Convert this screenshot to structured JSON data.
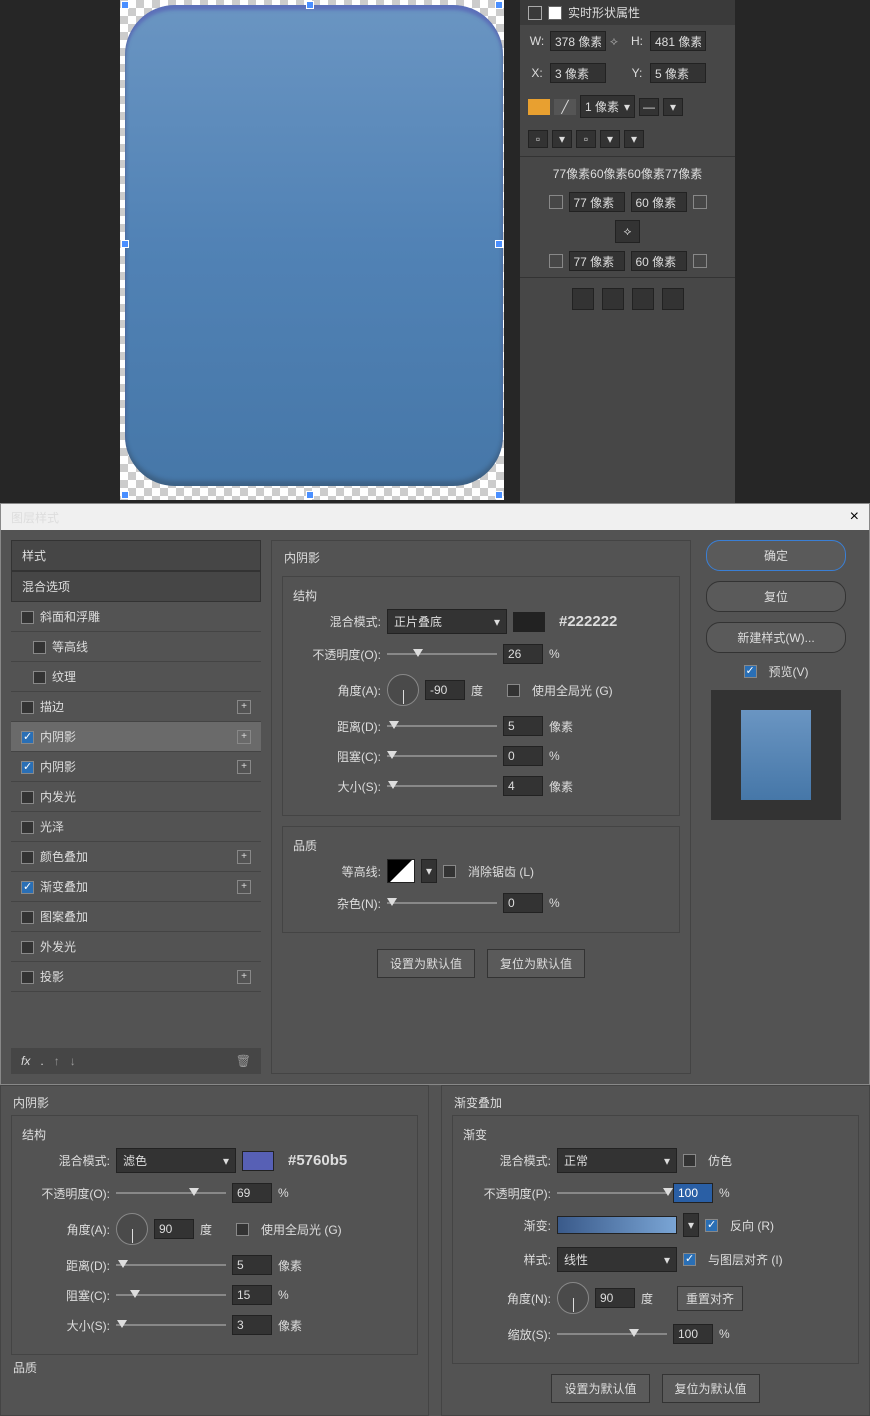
{
  "props": {
    "title": "实时形状属性",
    "w_label": "W:",
    "w": "378 像素",
    "h_label": "H:",
    "h": "481 像素",
    "x_label": "X:",
    "x": "3 像素",
    "y_label": "Y:",
    "y": "5 像素",
    "stroke": "1 像素",
    "corners_summary": "77像素60像素60像素77像素",
    "c_tl": "77 像素",
    "c_tr": "60 像素",
    "c_bl": "77 像素",
    "c_br": "60 像素"
  },
  "dialog": {
    "title": "图层样式",
    "styles_header": "样式",
    "blend_opts": "混合选项",
    "items": [
      {
        "label": "斜面和浮雕",
        "checked": false
      },
      {
        "label": "等高线",
        "checked": false,
        "indent": true
      },
      {
        "label": "纹理",
        "checked": false,
        "indent": true
      },
      {
        "label": "描边",
        "checked": false,
        "plus": true
      },
      {
        "label": "内阴影",
        "checked": true,
        "plus": true,
        "sel": true
      },
      {
        "label": "内阴影",
        "checked": true,
        "plus": true
      },
      {
        "label": "内发光",
        "checked": false
      },
      {
        "label": "光泽",
        "checked": false
      },
      {
        "label": "颜色叠加",
        "checked": false,
        "plus": true
      },
      {
        "label": "渐变叠加",
        "checked": true,
        "plus": true
      },
      {
        "label": "图案叠加",
        "checked": false
      },
      {
        "label": "外发光",
        "checked": false
      },
      {
        "label": "投影",
        "checked": false,
        "plus": true
      }
    ],
    "fx_label": "fx",
    "inner_shadow": {
      "title": "内阴影",
      "structure": "结构",
      "blend_mode_label": "混合模式:",
      "blend_mode": "正片叠底",
      "hex": "#222222",
      "opacity_label": "不透明度(O):",
      "opacity": "26",
      "opacity_unit": "%",
      "angle_label": "角度(A):",
      "angle": "-90",
      "angle_unit": "度",
      "global_light": "使用全局光 (G)",
      "distance_label": "距离(D):",
      "distance": "5",
      "distance_unit": "像素",
      "choke_label": "阻塞(C):",
      "choke": "0",
      "choke_unit": "%",
      "size_label": "大小(S):",
      "size": "4",
      "size_unit": "像素",
      "quality": "品质",
      "contour_label": "等高线:",
      "antialias": "消除锯齿 (L)",
      "noise_label": "杂色(N):",
      "noise": "0",
      "noise_unit": "%",
      "reset_default": "设置为默认值",
      "revert_default": "复位为默认值"
    },
    "buttons": {
      "ok": "确定",
      "reset": "复位",
      "new_style": "新建样式(W)...",
      "preview": "预览(V)"
    }
  },
  "panel2": {
    "title": "内阴影",
    "structure": "结构",
    "blend_mode_label": "混合模式:",
    "blend_mode": "滤色",
    "hex": "#5760b5",
    "opacity_label": "不透明度(O):",
    "opacity": "69",
    "opacity_unit": "%",
    "angle_label": "角度(A):",
    "angle": "90",
    "angle_unit": "度",
    "global_light": "使用全局光 (G)",
    "distance_label": "距离(D):",
    "distance": "5",
    "distance_unit": "像素",
    "choke_label": "阻塞(C):",
    "choke": "15",
    "choke_unit": "%",
    "size_label": "大小(S):",
    "size": "3",
    "size_unit": "像素",
    "quality": "品质"
  },
  "panel3": {
    "title": "渐变叠加",
    "gradient_section": "渐变",
    "blend_mode_label": "混合模式:",
    "blend_mode": "正常",
    "dither": "仿色",
    "opacity_label": "不透明度(P):",
    "opacity": "100",
    "opacity_unit": "%",
    "gradient_label": "渐变:",
    "reverse": "反向 (R)",
    "style_label": "样式:",
    "style": "线性",
    "align_layer": "与图层对齐 (I)",
    "angle_label": "角度(N):",
    "angle": "90",
    "angle_unit": "度",
    "reset_align": "重置对齐",
    "scale_label": "缩放(S):",
    "scale": "100",
    "scale_unit": "%",
    "reset_default": "设置为默认值",
    "revert_default": "复位为默认值"
  }
}
